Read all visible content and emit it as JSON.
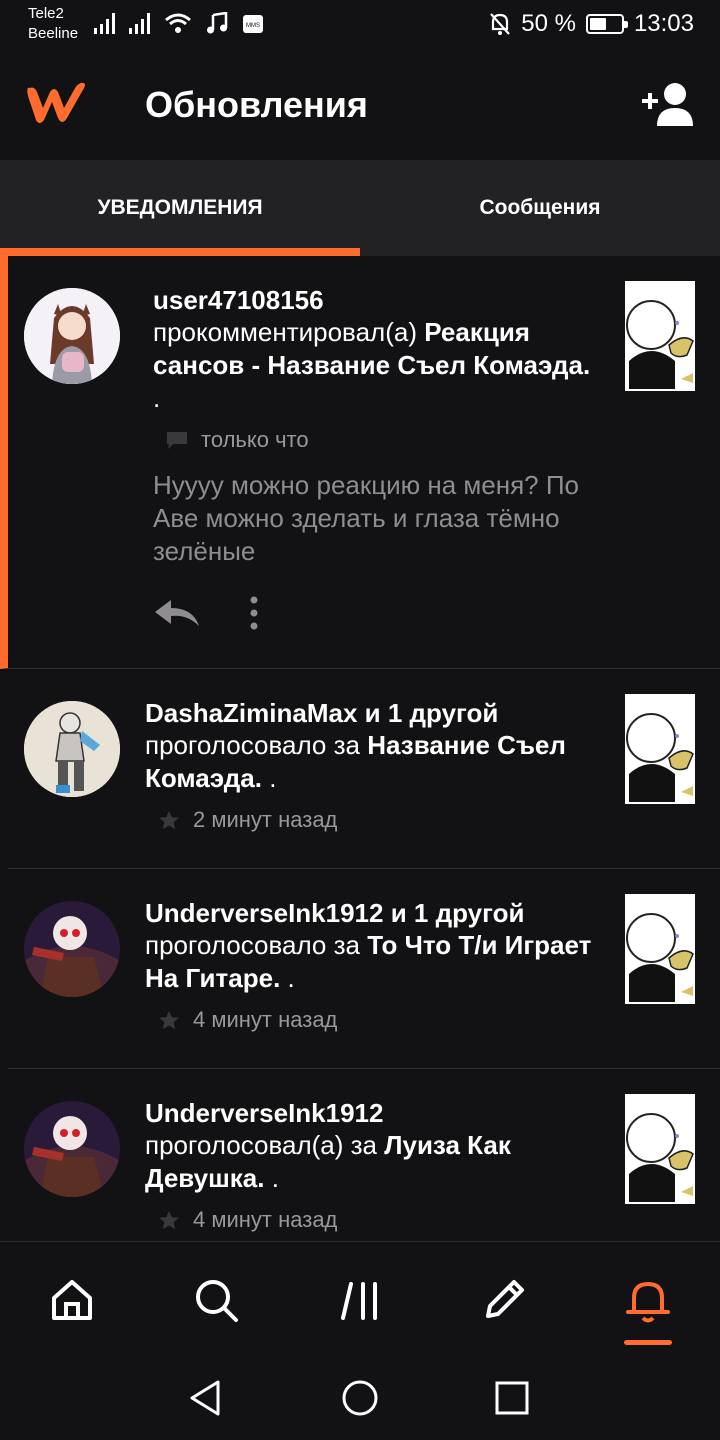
{
  "status_bar": {
    "carrier1": "Tele2",
    "carrier2": "Beeline",
    "battery": "50 %",
    "time": "13:03",
    "icons": [
      "signal-icon",
      "signal-icon",
      "wifi-icon",
      "music-icon",
      "mms-icon",
      "mute-icon",
      "battery-icon"
    ]
  },
  "header": {
    "title": "Обновления",
    "logo": "wattpad-logo",
    "action_icon": "add-user-icon"
  },
  "tabs": [
    {
      "label": "УВЕДОМЛЕНИЯ",
      "active": true
    },
    {
      "label": "Сообщения",
      "active": false
    }
  ],
  "notifications": [
    {
      "user": "user47108156",
      "action": "прокомментировал(а) ",
      "story": "Реакция сансов - Название Съел Комаэда.",
      "suffix": " .",
      "icon": "comment-icon",
      "time": "только что",
      "comment": "Нуууу можно реакцию на меня? По Аве можно зделать и глаза тёмно зелёные",
      "highlight": true
    },
    {
      "user": "DashaZiminaMax и 1 другой",
      "action": "проголосовало за ",
      "story": "Название Съел Комаэда.",
      "suffix": " .",
      "icon": "star-icon",
      "time": "2 минут назад"
    },
    {
      "user": "UnderverseInk1912 и 1 другой",
      "action": "проголосовало за ",
      "story": "То Что Т/и Играет На Гитаре.",
      "suffix": " .",
      "icon": "star-icon",
      "time": "4 минут назад"
    },
    {
      "user": "UnderverseInk1912",
      "action": "проголосовал(а) за ",
      "story": "Луиза Как Девушка.",
      "suffix": " .",
      "icon": "star-icon",
      "time": "4 минут назад"
    }
  ],
  "bottom_nav": [
    "home-icon",
    "search-icon",
    "library-icon",
    "write-icon",
    "notifications-icon"
  ],
  "colors": {
    "accent": "#ff6c2d",
    "background": "#121113",
    "tabs_bg": "#222124",
    "muted": "#9a989c"
  }
}
